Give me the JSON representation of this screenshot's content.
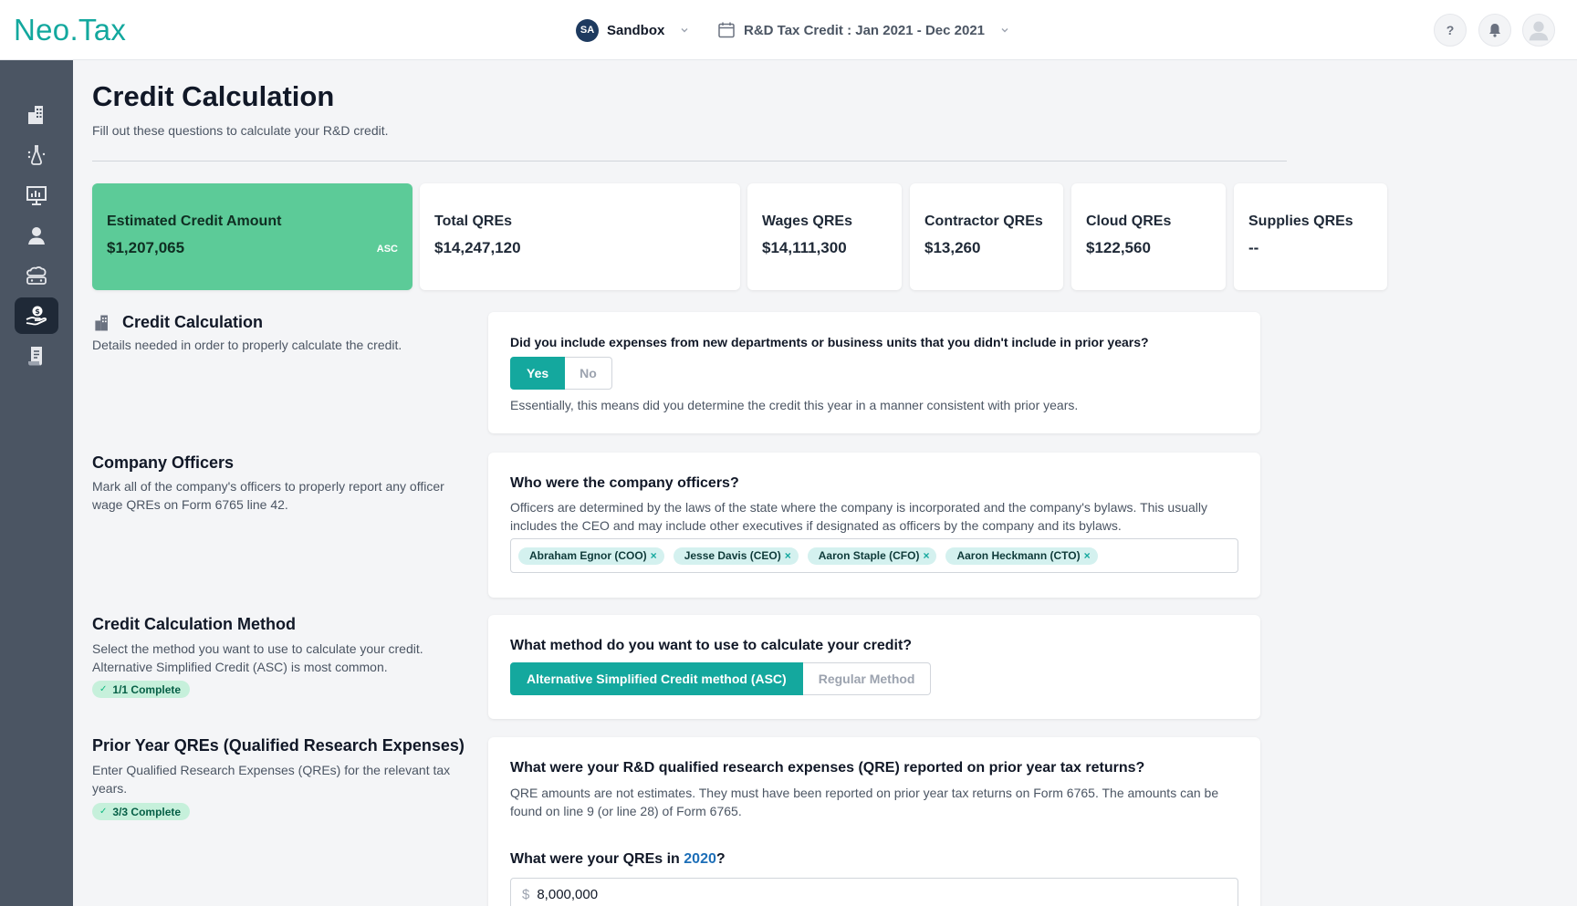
{
  "header": {
    "logo": "Neo.Tax",
    "workspace": {
      "initials": "SA",
      "name": "Sandbox"
    },
    "period": {
      "label": "R&D Tax Credit : Jan 2021 - Dec 2021"
    },
    "help_label": "?"
  },
  "sidebar": {
    "items": [
      {
        "icon": "buildings-icon",
        "active": false
      },
      {
        "icon": "flask-brain-icon",
        "active": false
      },
      {
        "icon": "presentation-board-icon",
        "active": false
      },
      {
        "icon": "user-icon",
        "active": false
      },
      {
        "icon": "cloud-devices-icon",
        "active": false
      },
      {
        "icon": "hand-dollar-icon",
        "active": true
      },
      {
        "icon": "document-icon",
        "active": false
      }
    ]
  },
  "page": {
    "title": "Credit Calculation",
    "subtitle": "Fill out these questions to calculate your R&D credit."
  },
  "stats": [
    {
      "label": "Estimated Credit Amount",
      "value": "$1,207,065",
      "badge": "ASC"
    },
    {
      "label": "Total QREs",
      "value": "$14,247,120"
    },
    {
      "label": "Wages QREs",
      "value": "$14,111,300"
    },
    {
      "label": "Contractor QREs",
      "value": "$13,260"
    },
    {
      "label": "Cloud QREs",
      "value": "$122,560"
    },
    {
      "label": "Supplies QREs",
      "value": "--"
    }
  ],
  "sections": {
    "credit_calc": {
      "title": "Credit Calculation",
      "desc": "Details needed in order to properly calculate the credit.",
      "question": "Did you include expenses from new departments or business units that you didn't include in prior years?",
      "yes": "Yes",
      "no": "No",
      "help": "Essentially, this means did you determine the credit this year in a manner consistent with prior years."
    },
    "officers": {
      "title": "Company Officers",
      "desc": "Mark all of the company's officers to properly report any officer wage QREs on Form 6765 line 42.",
      "question": "Who were the company officers?",
      "help": "Officers are determined by the laws of the state where the company is incorporated and the company's bylaws. This usually includes the CEO and may include other executives if designated as officers by the company and its bylaws.",
      "tags": [
        "Abraham Egnor (COO)",
        "Jesse Davis (CEO)",
        "Aaron Staple (CFO)",
        "Aaron Heckmann (CTO)"
      ],
      "remove_glyph": "×"
    },
    "method": {
      "title": "Credit Calculation Method",
      "desc": "Select the method you want to use to calculate your credit. Alternative Simplified Credit (ASC) is most common.",
      "badge": "1/1 Complete",
      "question": "What method do you want to use to calculate your credit?",
      "opt_asc": "Alternative Simplified Credit method (ASC)",
      "opt_regular": "Regular Method"
    },
    "prior": {
      "title": "Prior Year QREs (Qualified Research Expenses)",
      "desc": "Enter Qualified Research Expenses (QREs) for the relevant tax years.",
      "badge": "3/3 Complete",
      "question": "What were your R&D qualified research expenses (QRE) reported on prior year tax returns?",
      "help": "QRE amounts are not estimates. They must have been reported on prior year tax returns on Form 6765. The amounts can be found on line 9 (or line 28) of Form 6765.",
      "year_q_prefix": "What were your QREs in ",
      "year": "2020",
      "year_q_suffix": "?",
      "currency": "$",
      "value": "8,000,000"
    }
  },
  "colors": {
    "brand": "#13a89e",
    "accent": "#14a89e",
    "estimate_bg": "#5ccb98",
    "sidebar": "#4b5563"
  }
}
